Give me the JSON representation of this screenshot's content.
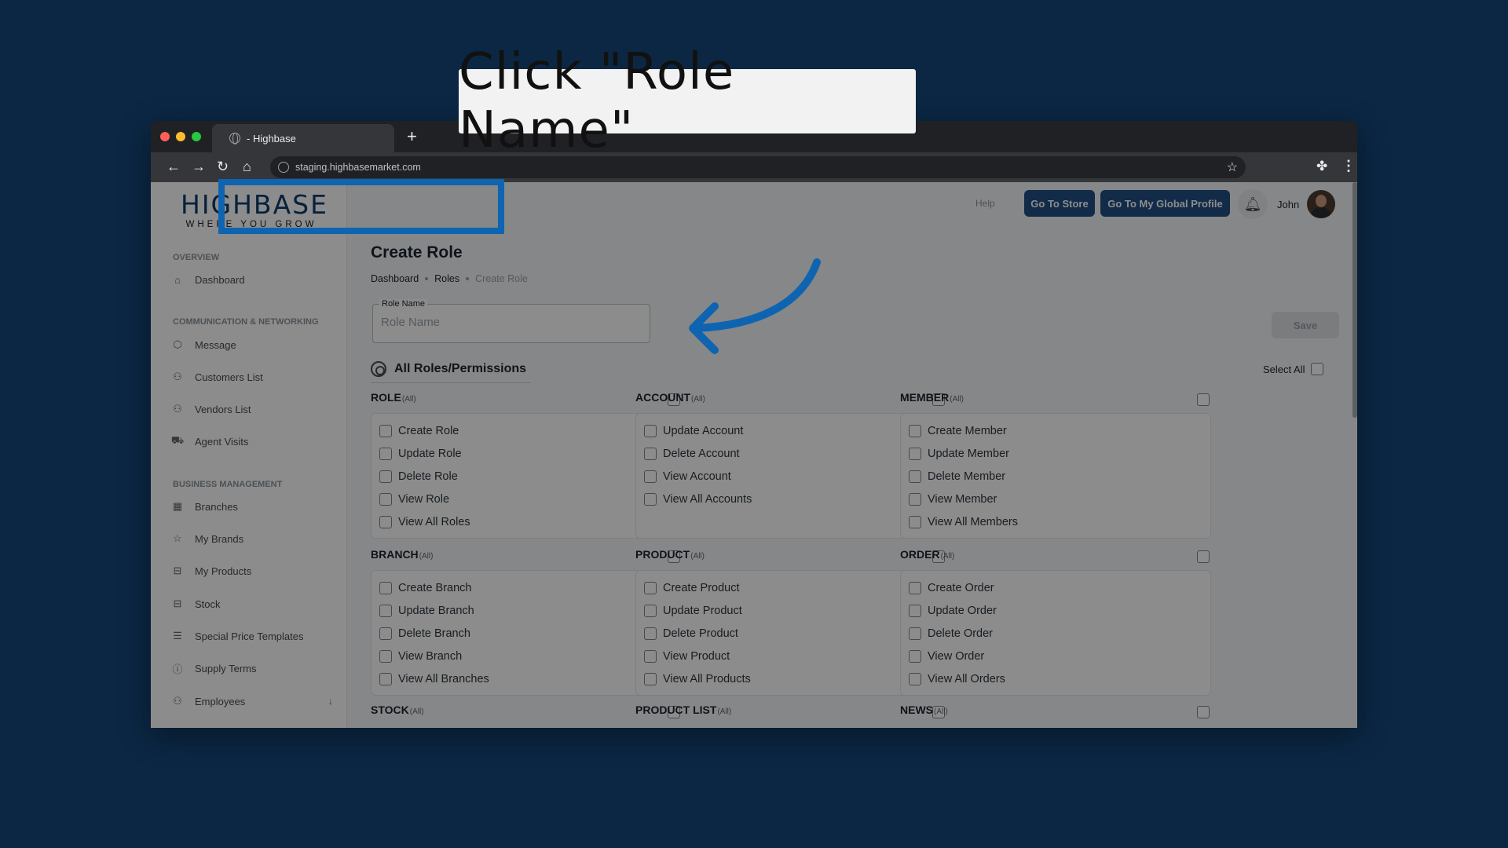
{
  "browser": {
    "tab_title": "- Highbase",
    "url": "staging.highbasemarket.com"
  },
  "logo": {
    "main": "HIGHBASE",
    "sub": "WHERE YOU GROW"
  },
  "sidebar": {
    "sections": [
      {
        "label": "OVERVIEW"
      },
      {
        "label": "COMMUNICATION & NETWORKING"
      },
      {
        "label": "BUSINESS MANAGEMENT"
      }
    ],
    "items": [
      {
        "label": "Dashboard",
        "icon": "home-icon"
      },
      {
        "label": "Message",
        "icon": "cube-icon"
      },
      {
        "label": "Customers List",
        "icon": "users-icon"
      },
      {
        "label": "Vendors List",
        "icon": "users-icon"
      },
      {
        "label": "Agent Visits",
        "icon": "truck-icon"
      },
      {
        "label": "Branches",
        "icon": "store-icon"
      },
      {
        "label": "My Brands",
        "icon": "star-icon"
      },
      {
        "label": "My Products",
        "icon": "box-icon"
      },
      {
        "label": "Stock",
        "icon": "box-icon"
      },
      {
        "label": "Special Price Templates",
        "icon": "list-icon"
      },
      {
        "label": "Supply Terms",
        "icon": "info-icon"
      },
      {
        "label": "Employees",
        "icon": "users-icon"
      }
    ]
  },
  "topbar": {
    "help": "Help",
    "store_button": "Go To Store",
    "profile_button": "Go To My Global Profile",
    "user_name": "John"
  },
  "page": {
    "title": "Create Role",
    "breadcrumb": [
      "Dashboard",
      "Roles",
      "Create Role"
    ],
    "role_name_label": "Role Name",
    "role_name_placeholder": "Role Name",
    "save_label": "Save",
    "permissions_title": "All Roles/Permissions",
    "select_all_label": "Select All",
    "all_suffix": "(All)"
  },
  "groups": [
    {
      "name": "ROLE",
      "items": [
        "Create Role",
        "Update Role",
        "Delete Role",
        "View Role",
        "View All Roles"
      ]
    },
    {
      "name": "ACCOUNT",
      "items": [
        "Update Account",
        "Delete Account",
        "View Account",
        "View All Accounts"
      ]
    },
    {
      "name": "MEMBER",
      "items": [
        "Create Member",
        "Update Member",
        "Delete Member",
        "View Member",
        "View All Members"
      ]
    },
    {
      "name": "BRANCH",
      "items": [
        "Create Branch",
        "Update Branch",
        "Delete Branch",
        "View Branch",
        "View All Branches"
      ]
    },
    {
      "name": "PRODUCT",
      "items": [
        "Create Product",
        "Update Product",
        "Delete Product",
        "View Product",
        "View All Products"
      ]
    },
    {
      "name": "ORDER",
      "items": [
        "Create Order",
        "Update Order",
        "Delete Order",
        "View Order",
        "View All Orders"
      ]
    },
    {
      "name": "STOCK",
      "items": []
    },
    {
      "name": "PRODUCT LIST",
      "items": []
    },
    {
      "name": "NEWS",
      "items": []
    }
  ],
  "overlay": {
    "callout_text": "Click \"Role Name\"",
    "highlight_color": "#0e64b0",
    "background_color": "#0b2744"
  }
}
